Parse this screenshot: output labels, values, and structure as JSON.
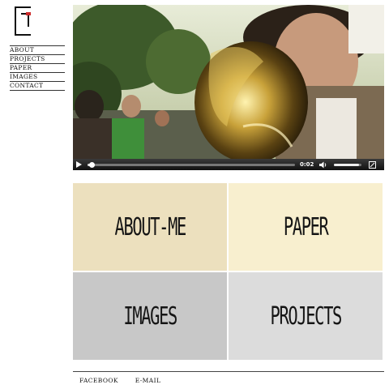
{
  "logo": {
    "icon": "monogram-logo-icon",
    "accent": "#cc2a2a"
  },
  "nav": {
    "items": [
      {
        "label": "ABOUT"
      },
      {
        "label": "PROJECTS"
      },
      {
        "label": "PAPER"
      },
      {
        "label": "IMAGES"
      },
      {
        "label": "CONTACT"
      }
    ]
  },
  "video": {
    "time": "0:02",
    "progress": 0.02,
    "volume": 0.9,
    "controls": {
      "play_icon": "play-icon",
      "volume_icon": "speaker-icon",
      "fullscreen_icon": "fullscreen-icon"
    }
  },
  "tiles": [
    {
      "label": "ABOUT-ME",
      "color": "#ece0be"
    },
    {
      "label": "PAPER",
      "color": "#f8efcf"
    },
    {
      "label": "IMAGES",
      "color": "#c8c8c8"
    },
    {
      "label": "PROJECTS",
      "color": "#dcdcdc"
    }
  ],
  "footer": {
    "facebook": "FACEBOOK",
    "email": "E-MAIL"
  }
}
